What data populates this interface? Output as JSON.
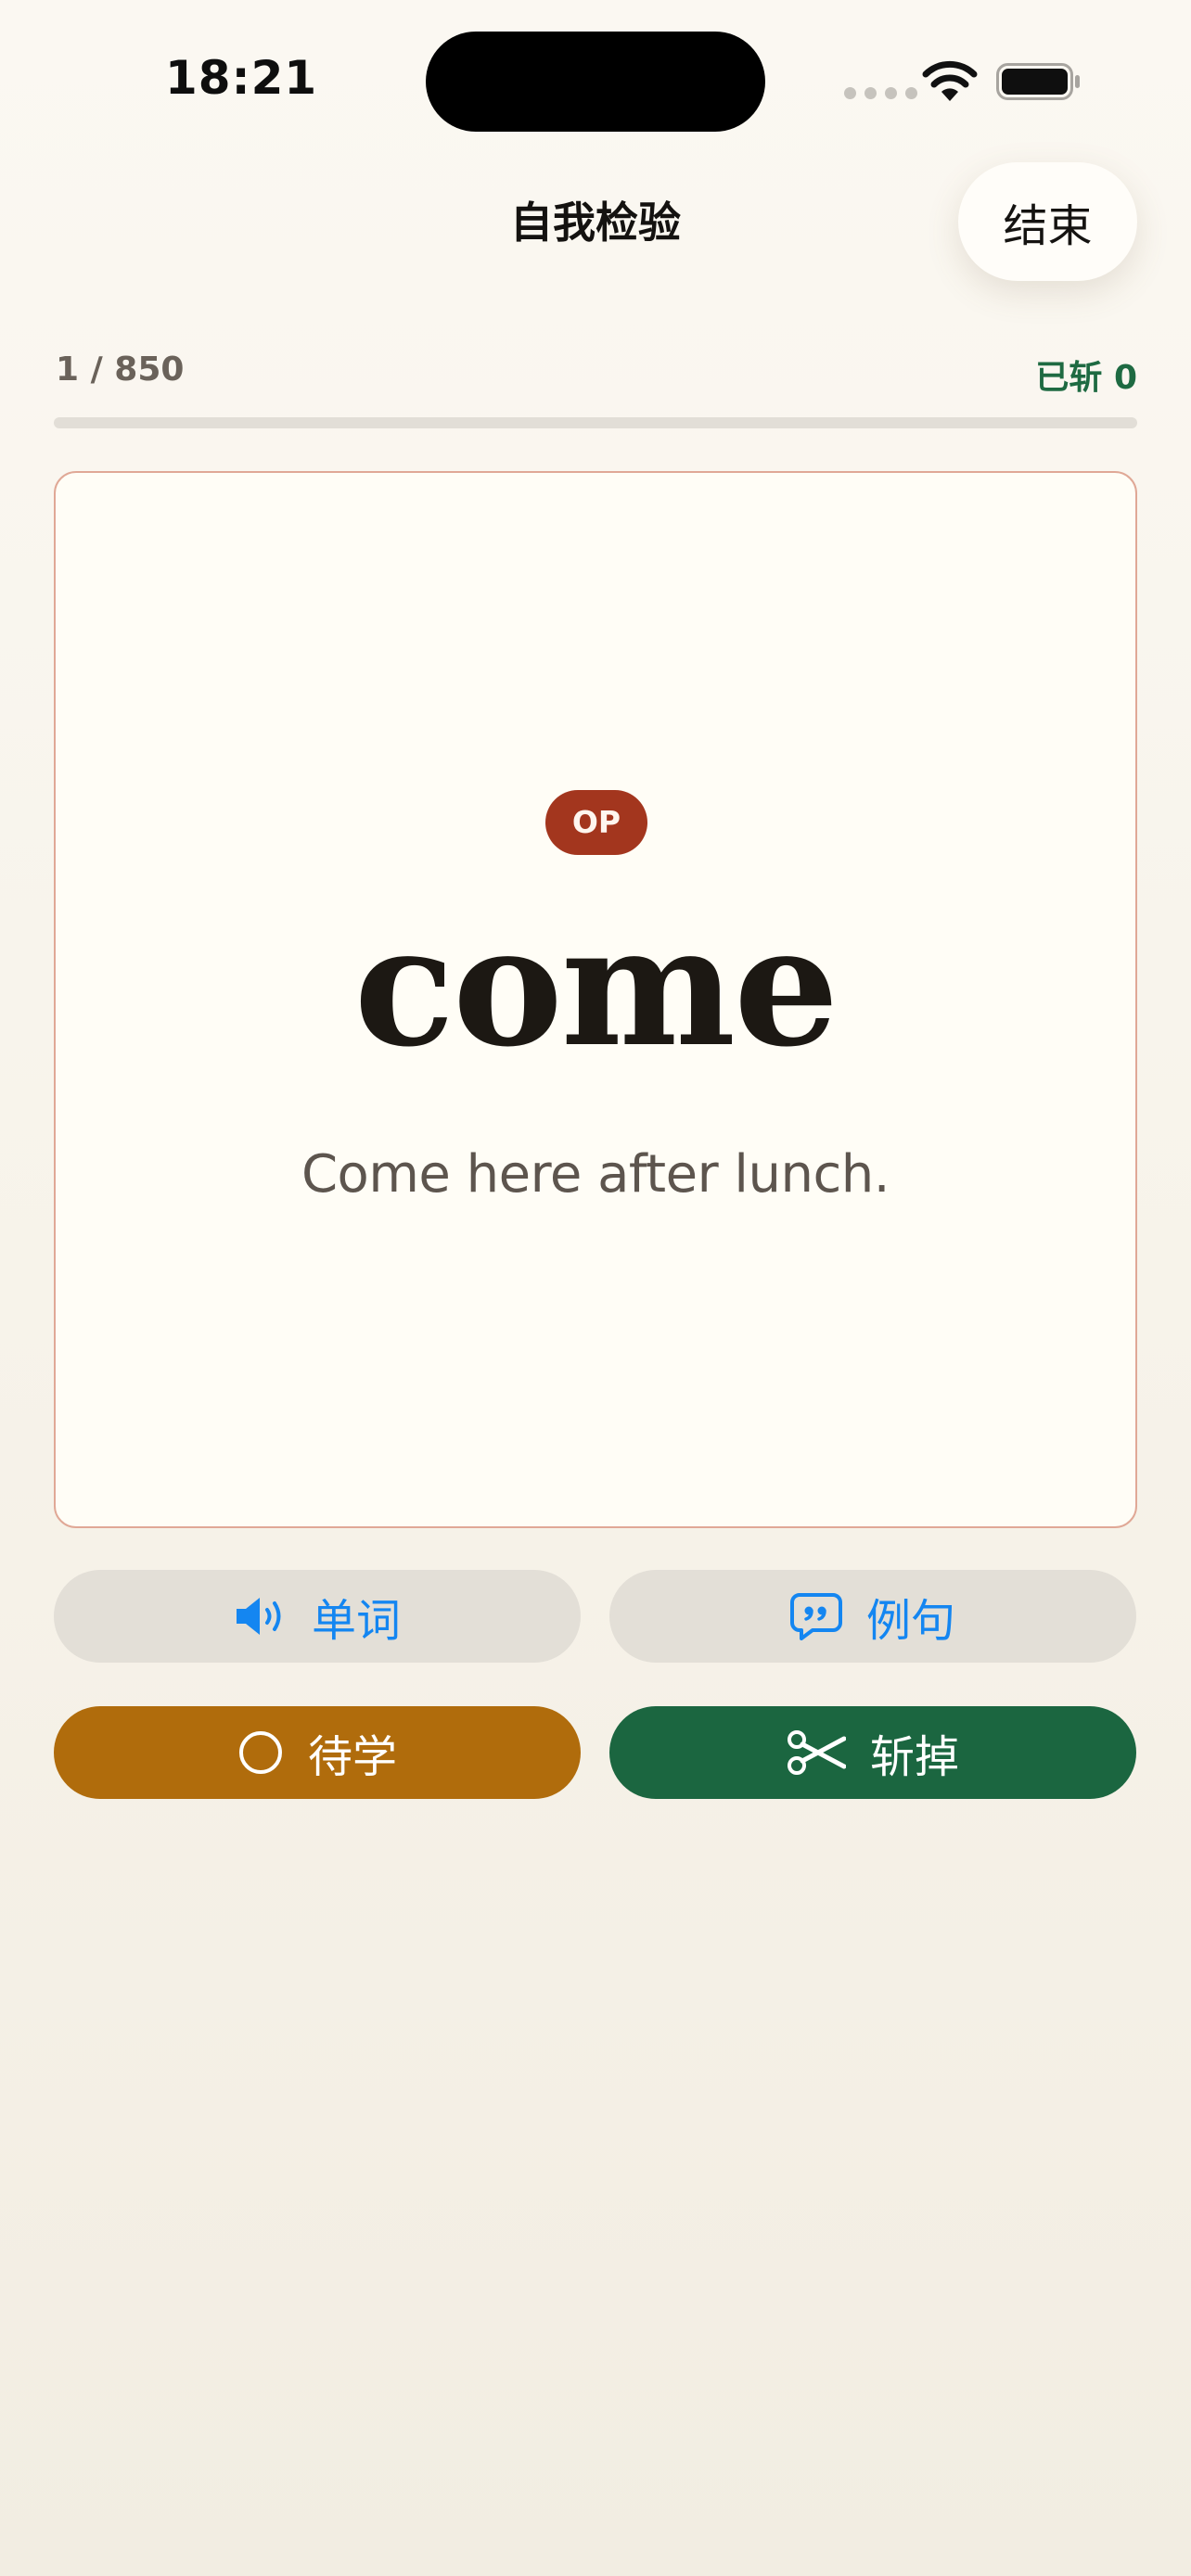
{
  "status_bar": {
    "time": "18:21"
  },
  "nav": {
    "title": "自我检验",
    "end_label": "结束"
  },
  "progress": {
    "count_text": "1 / 850",
    "slain_text": "已斩 0",
    "fill_fraction": 0
  },
  "card": {
    "badge": "OP",
    "word": "come",
    "sentence": "Come here after lunch."
  },
  "actions": {
    "word_audio_label": "单词",
    "sentence_audio_label": "例句",
    "learn_label": "待学",
    "slay_label": "斩掉"
  },
  "icons": {
    "word_audio": "speaker-icon",
    "sentence_audio": "quote-bubble-icon",
    "learn": "circle-icon",
    "slay": "scissors-icon"
  },
  "colors": {
    "accent_blue": "#1486f1",
    "learn_orange": "#b06c0c",
    "slay_green": "#1b6640",
    "badge_red": "#a3361e",
    "card_border": "#e0a896"
  }
}
